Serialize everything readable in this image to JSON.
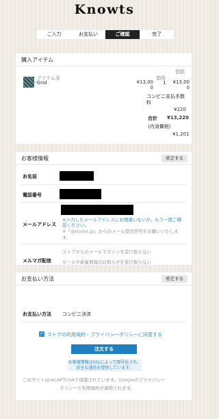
{
  "logo": "Knowts",
  "steps": [
    "ご入力",
    "お支払い",
    "ご確認",
    "完了"
  ],
  "purchase": {
    "title": "購入アイテム",
    "item_name_header": "アイテム名",
    "price_header": "価格",
    "qty_header": "個数",
    "item_name": "-Grid",
    "item_price": "¥13,00 0",
    "item_qty": "1",
    "item_total": "¥13,00 0",
    "fee_label": "コンビニ支払手数料",
    "fee_value": "¥220",
    "total_label": "合計",
    "total_value": "¥13,220",
    "tax_label": "(内消費税)",
    "tax_value": "¥1,201"
  },
  "customer": {
    "title": "お客様情報",
    "edit_label": "修正する",
    "name_label": "お名前",
    "phone_label": "電話番号",
    "email_label": "メールアドレス",
    "email_note1": "※入力したメールアドレスにお間違いないか、もう一度ご確認ください。",
    "email_note2": "※「@stores.jp」からのメール受信許可をお願いいたします。",
    "magazine_label": "メルマガ配信",
    "magazine_line1": "ストアからのメールマガジンを受け取らない",
    "magazine_line2": "セールや新着情報のお知らせを受け取らない"
  },
  "payment": {
    "title": "お支払い方法",
    "edit_label": "修正する",
    "method_label": "お支払い方法",
    "method_value": "コンビニ決済",
    "agree_text": "ストアの利用規約・プライバシーポリシーに同意する",
    "order_button": "注文する",
    "ssl_note": "お客様情報はSSLによって暗号化され、安全な通信を提供しています。",
    "recaptcha_1": "このサイトはreCAPTCHAで保護されています。Googleのプライバシー",
    "recaptcha_2": "ポリシーと利用規約が適用されます。"
  }
}
